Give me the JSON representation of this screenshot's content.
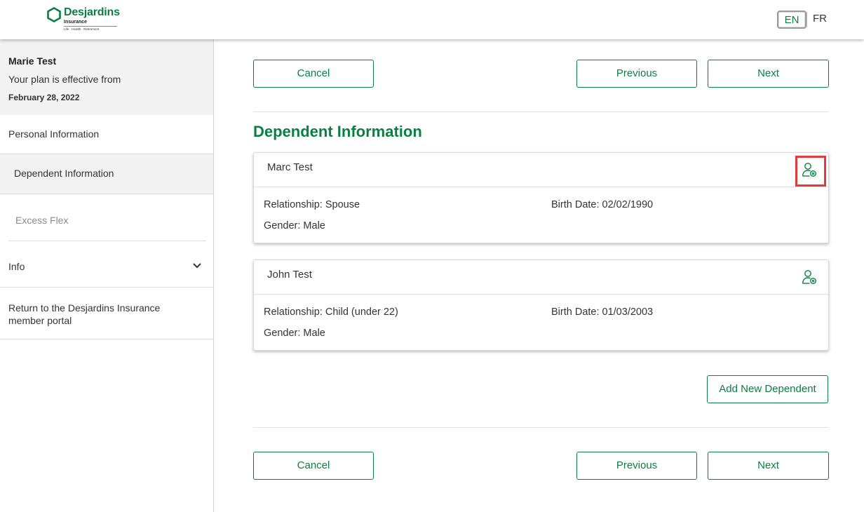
{
  "header": {
    "logo_name": "Desjardins",
    "logo_sub": "Insurance",
    "logo_tagline": "Life · Health · Retirement",
    "lang_en": "EN",
    "lang_fr": "FR"
  },
  "colors": {
    "brand_green": "#0a7f42",
    "highlight_red": "#e03c3c"
  },
  "sidebar": {
    "name": "Marie Test",
    "effective_label": "Your plan is effective from",
    "effective_date": "February 28, 2022",
    "items": [
      {
        "label": "Personal Information"
      },
      {
        "label": "Dependent Information"
      },
      {
        "label": "Excess Flex"
      },
      {
        "label": "Info"
      },
      {
        "label": "Return to the Desjardins Insurance member portal"
      }
    ]
  },
  "nav_buttons": {
    "cancel": "Cancel",
    "previous": "Previous",
    "next": "Next"
  },
  "section_title": "Dependent Information",
  "dependents": [
    {
      "name": "Marc Test",
      "relationship": "Relationship: Spouse",
      "birth_date": "Birth Date: 02/02/1990",
      "gender": "Gender: Male",
      "icon": "remove-dependent-icon"
    },
    {
      "name": "John Test",
      "relationship": "Relationship: Child (under 22)",
      "birth_date": "Birth Date: 01/03/2003",
      "gender": "Gender: Male",
      "icon": "remove-dependent-icon"
    }
  ],
  "add_dependent_label": "Add New Dependent"
}
